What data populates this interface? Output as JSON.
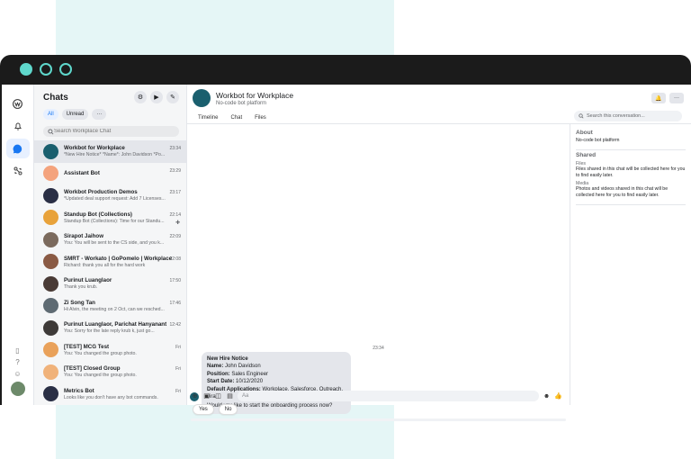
{
  "sidebar_title": "Chats",
  "filters": {
    "all": "All",
    "unread": "Unread",
    "more": "···"
  },
  "search_placeholder": "Search Workplace Chat",
  "chats": [
    {
      "name": "Workbot for Workplace",
      "preview": "*New Hire Notice* *Name*: John Davidson *Po...",
      "time": "23:34",
      "color": "#1a5f6e"
    },
    {
      "name": "Assistant Bot",
      "preview": "",
      "time": "23:29",
      "color": "#f4a37d"
    },
    {
      "name": "Workbot Production Demos",
      "preview": "*Updated deal support request: Add 7 Licenses...",
      "time": "23:17",
      "color": "#2a2f45"
    },
    {
      "name": "Standup Bot (Collections)",
      "preview": "Standup Bot (Collections): Time for our Standu...",
      "time": "22:14",
      "color": "#e8a23a",
      "pinned": "✚"
    },
    {
      "name": "Sirapot Jaihow",
      "preview": "You: You will be sent to the CS side, and you k...",
      "time": "22:09",
      "color": "#7b6a5d"
    },
    {
      "name": "SMRT - Workato | GoPomelo | Workplace",
      "preview": "Richard: thank you all for the hard work",
      "time": "22:08",
      "color": "#8a5a44"
    },
    {
      "name": "Purinut Luanglaor",
      "preview": "Thank you krub.",
      "time": "17:50",
      "color": "#4a3b36"
    },
    {
      "name": "Zi Song Tan",
      "preview": "Hi Alvin, the meeting on 2 Oct, can we resched...",
      "time": "17:46",
      "color": "#5f6b73"
    },
    {
      "name": "Purinut Luanglaor, Parichat Hanyanant",
      "preview": "You: Sorry for the late reply krub k, just go...",
      "time": "12:42",
      "color": "#3e3a38"
    },
    {
      "name": "[TEST] MCG Test",
      "preview": "You: You changed the group photo.",
      "time": "Fri",
      "color": "#e9a15a"
    },
    {
      "name": "[TEST] Closed Group",
      "preview": "You: You changed the group photo.",
      "time": "Fri",
      "color": "#f0b27a"
    },
    {
      "name": "Metrics Bot",
      "preview": "Looks like you don't have any bot commands.",
      "time": "Fri",
      "color": "#2a2f45"
    }
  ],
  "header": {
    "title": "Workbot for Workplace",
    "subtitle": "No-code bot platform"
  },
  "tabs": [
    "Timeline",
    "Chat",
    "Files"
  ],
  "conversation_search": "Search this conversation...",
  "about": {
    "title": "About",
    "text": "No-code bot platform",
    "shared_title": "Shared",
    "files_label": "Files",
    "files_text": "Files shared in this chat will be collected here for you to find easily later.",
    "media_label": "Media",
    "media_text": "Photos and videos shared in this chat will be collected here for you to find easily later."
  },
  "message": {
    "time": "23:34",
    "title": "New Hire Notice",
    "fields": [
      {
        "label": "Name",
        "value": "John Davidson"
      },
      {
        "label": "Position",
        "value": "Sales Engineer"
      },
      {
        "label": "Start Date",
        "value": "10/12/2020"
      },
      {
        "label": "Default Applications",
        "value": "Workplace, Salesforce, Outreach, Jira"
      }
    ],
    "question": "Would you like to start the onboarding process now?"
  },
  "quick_replies": [
    "Yes",
    "No"
  ],
  "composer_placeholder": "Aa",
  "colors": {
    "accent": "#1877f2",
    "traffic": "#5fd8cc",
    "frame": "#1b1b1b"
  }
}
